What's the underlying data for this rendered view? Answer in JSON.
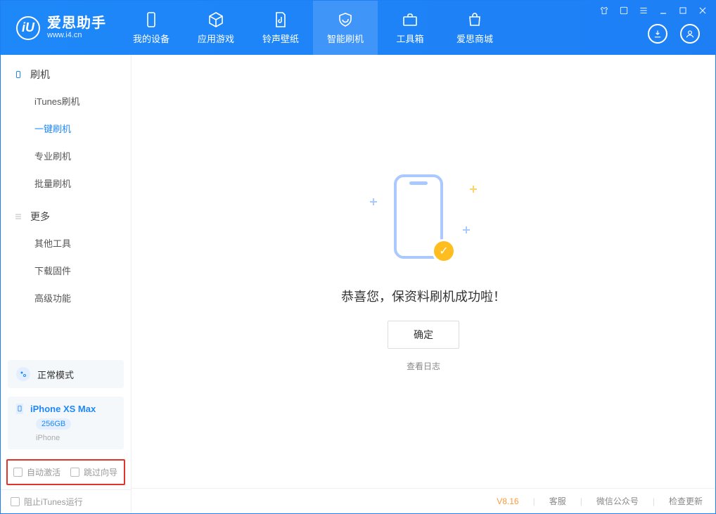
{
  "logo": {
    "title": "爱思助手",
    "subtitle": "www.i4.cn",
    "mark": "iU"
  },
  "nav": {
    "items": [
      {
        "label": "我的设备"
      },
      {
        "label": "应用游戏"
      },
      {
        "label": "铃声壁纸"
      },
      {
        "label": "智能刷机"
      },
      {
        "label": "工具箱"
      },
      {
        "label": "爱思商城"
      }
    ]
  },
  "sidebar": {
    "section1_title": "刷机",
    "section1": [
      {
        "label": "iTunes刷机"
      },
      {
        "label": "一键刷机"
      },
      {
        "label": "专业刷机"
      },
      {
        "label": "批量刷机"
      }
    ],
    "section2_title": "更多",
    "section2": [
      {
        "label": "其他工具"
      },
      {
        "label": "下载固件"
      },
      {
        "label": "高级功能"
      }
    ],
    "mode_label": "正常模式",
    "device_name": "iPhone XS Max",
    "device_capacity": "256GB",
    "device_type": "iPhone",
    "chk_auto_activate": "自动激活",
    "chk_skip_guide": "跳过向导",
    "chk_block_itunes": "阻止iTunes运行"
  },
  "main": {
    "success_text": "恭喜您，保资料刷机成功啦！",
    "ok_button": "确定",
    "view_log": "查看日志"
  },
  "footer": {
    "version": "V8.16",
    "links": [
      "客服",
      "微信公众号",
      "检查更新"
    ]
  }
}
